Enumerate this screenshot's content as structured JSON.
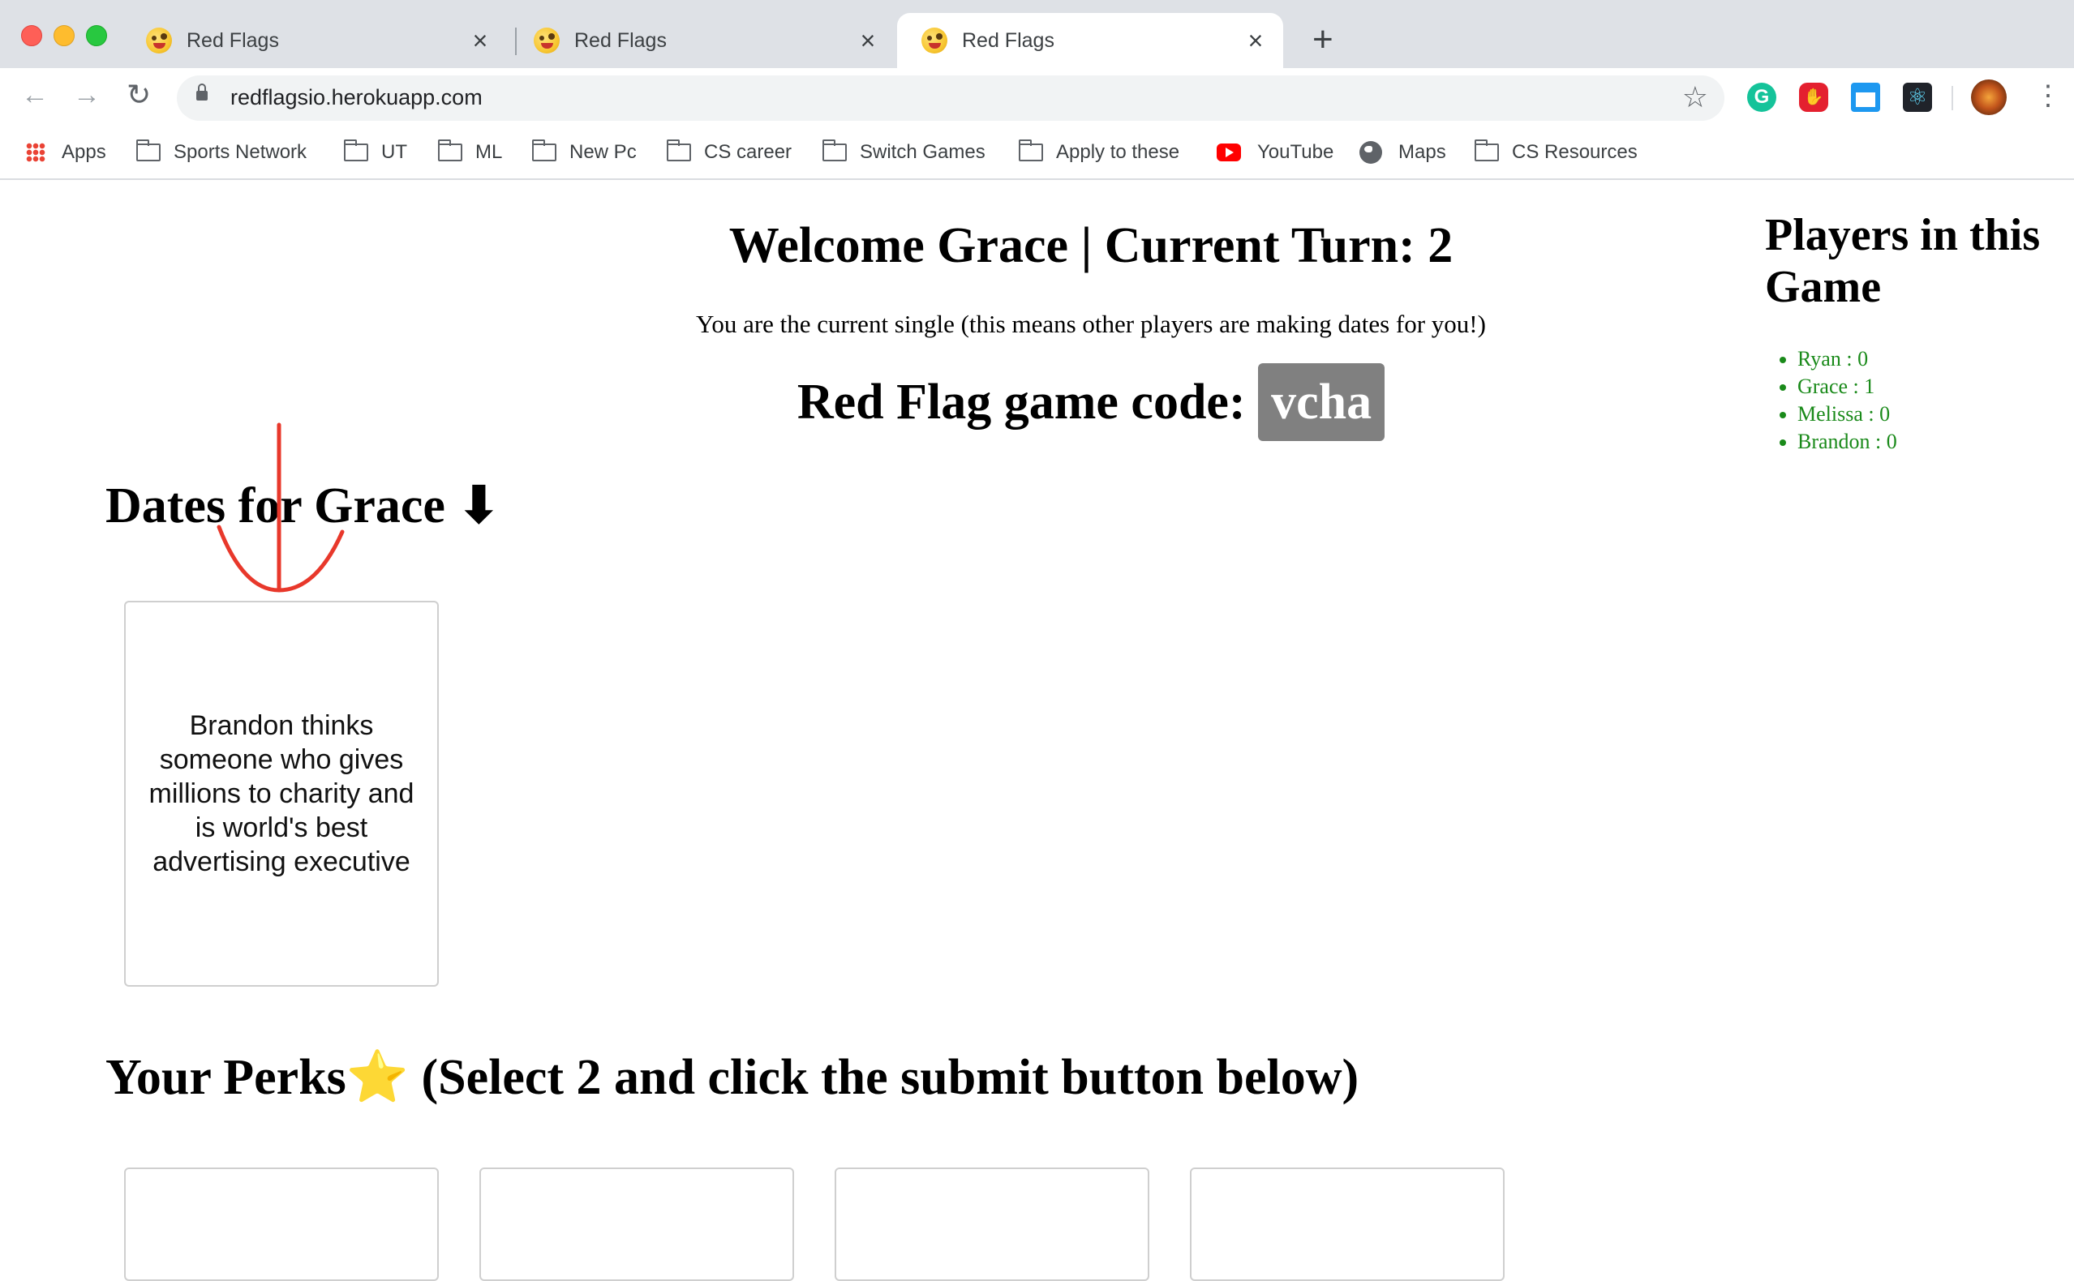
{
  "browser": {
    "tabs": [
      {
        "title": "Red Flags",
        "active": false
      },
      {
        "title": "Red Flags",
        "active": false
      },
      {
        "title": "Red Flags",
        "active": true
      }
    ],
    "url": "redflagsio.herokuapp.com",
    "bookmarks": [
      {
        "label": "Apps",
        "icon": "apps-grid-icon"
      },
      {
        "label": "Sports Network",
        "icon": "folder-icon"
      },
      {
        "label": "UT",
        "icon": "folder-icon"
      },
      {
        "label": "ML",
        "icon": "folder-icon"
      },
      {
        "label": "New Pc",
        "icon": "folder-icon"
      },
      {
        "label": "CS career",
        "icon": "folder-icon"
      },
      {
        "label": "Switch Games",
        "icon": "folder-icon"
      },
      {
        "label": "Apply to these",
        "icon": "folder-icon"
      },
      {
        "label": "YouTube",
        "icon": "youtube-icon"
      },
      {
        "label": "Maps",
        "icon": "globe-icon"
      },
      {
        "label": "CS Resources",
        "icon": "folder-icon"
      }
    ]
  },
  "game": {
    "welcome": "Welcome Grace | Current Turn: 2",
    "single_note": "You are the current single (this means other players are making dates for you!)",
    "code_label": "Red Flag game code:",
    "code": "vcha",
    "dates_heading": "Dates for Grace ⬇",
    "date_card_text": "Brandon thinks someone who gives millions to charity and is world's best advertising executive",
    "perks_heading": "Your Perks⭐ (Select 2 and click the submit button below)"
  },
  "players": {
    "heading": "Players in this Game",
    "list": [
      "Ryan : 0",
      "Grace : 1",
      "Melissa : 0",
      "Brandon : 0"
    ]
  },
  "colors": {
    "player_list": "#1a8a1a",
    "code_badge": "#808080",
    "annotation_stroke": "#e8382b"
  }
}
